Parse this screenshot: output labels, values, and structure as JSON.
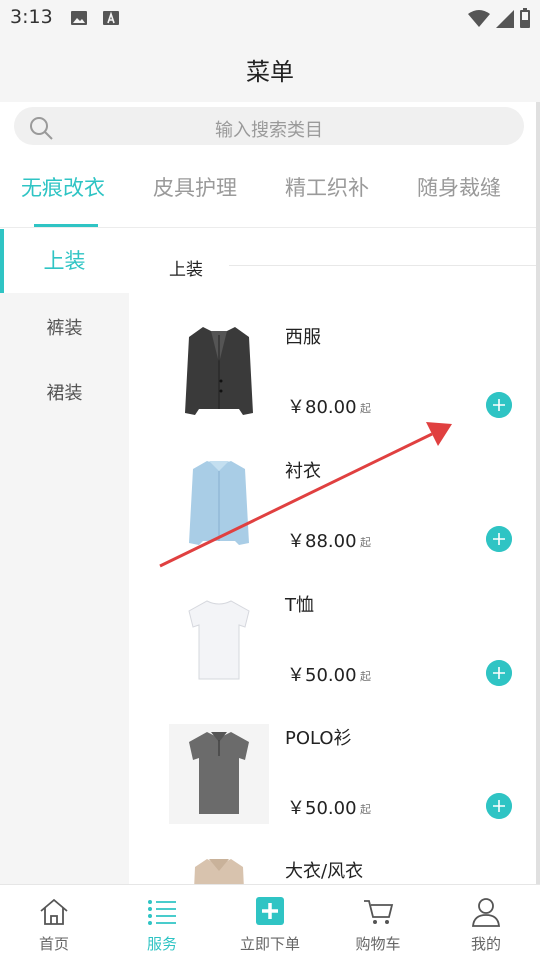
{
  "status_bar": {
    "time": "3:13"
  },
  "header": {
    "title": "菜单"
  },
  "search": {
    "placeholder": "输入搜索类目"
  },
  "tabs": [
    {
      "label": "无痕改衣",
      "active": true
    },
    {
      "label": "皮具护理",
      "active": false
    },
    {
      "label": "精工织补",
      "active": false
    },
    {
      "label": "随身裁缝",
      "active": false
    }
  ],
  "sidebar": [
    {
      "label": "上装",
      "active": true
    },
    {
      "label": "裤装",
      "active": false
    },
    {
      "label": "裙装",
      "active": false
    }
  ],
  "section": {
    "title": "上装"
  },
  "products": [
    {
      "name": "西服",
      "price": "￥80.00",
      "suffix": "起",
      "image": "suit-jacket-dark-gray"
    },
    {
      "name": "衬衣",
      "price": "￥88.00",
      "suffix": "起",
      "image": "light-blue-dress-shirt"
    },
    {
      "name": "T恤",
      "price": "￥50.00",
      "suffix": "起",
      "image": "white-t-shirt"
    },
    {
      "name": "POLO衫",
      "price": "￥50.00",
      "suffix": "起",
      "image": "gray-polo-shirt"
    },
    {
      "name": "大衣/风衣",
      "price": "",
      "suffix": "",
      "image": "beige-trench-coat"
    }
  ],
  "bottom_nav": [
    {
      "label": "首页",
      "icon": "home-icon",
      "active": false
    },
    {
      "label": "服务",
      "icon": "list-icon",
      "active": true
    },
    {
      "label": "立即下单",
      "icon": "plus-square-icon",
      "active": false
    },
    {
      "label": "购物车",
      "icon": "cart-icon",
      "active": false
    },
    {
      "label": "我的",
      "icon": "user-icon",
      "active": false
    }
  ],
  "colors": {
    "accent": "#2fc4c4",
    "annotation": "#e04040"
  }
}
